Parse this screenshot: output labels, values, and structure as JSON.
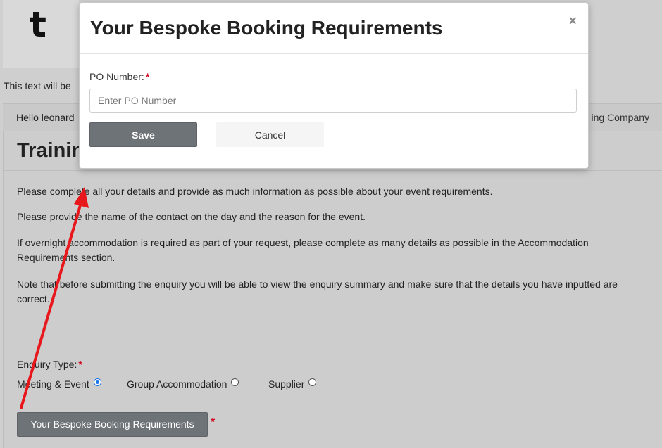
{
  "page": {
    "logo_letter": "t",
    "hidden_text": "This text will be",
    "greeting": "Hello leonard",
    "company": "ing Company",
    "title": "Trainin",
    "paragraphs": [
      "Please complete all your details and provide as much information as possible about your event requirements.",
      "Please provide the name of the contact on the day and the reason for the event.",
      "If overnight accommodation is required as part of your request, please complete as many details as possible in the Accommodation Requirements section.",
      "Note that before submitting the enquiry you will be able to view the enquiry summary and make sure that the details you have inputted are correct."
    ],
    "enquiry_type_label": "Enquiry Type:",
    "required_marker": "*",
    "enquiry_options": [
      {
        "label": "Meeting & Event",
        "selected": true
      },
      {
        "label": "Group Accommodation",
        "selected": false
      },
      {
        "label": "Supplier",
        "selected": false
      }
    ],
    "bespoke_button": "Your Bespoke Booking Requirements"
  },
  "modal": {
    "title": "Your Bespoke Booking Requirements",
    "close_symbol": "×",
    "po_label": "PO Number:",
    "po_value": "",
    "po_placeholder": "Enter PO Number",
    "save_label": "Save",
    "cancel_label": "Cancel"
  },
  "colors": {
    "accent": "#1a73e8",
    "required": "#d0021b",
    "button_gray": "#6e7378",
    "annotation_arrow": "#e8171b"
  },
  "annotation": {
    "icon": "red-arrow-icon"
  }
}
